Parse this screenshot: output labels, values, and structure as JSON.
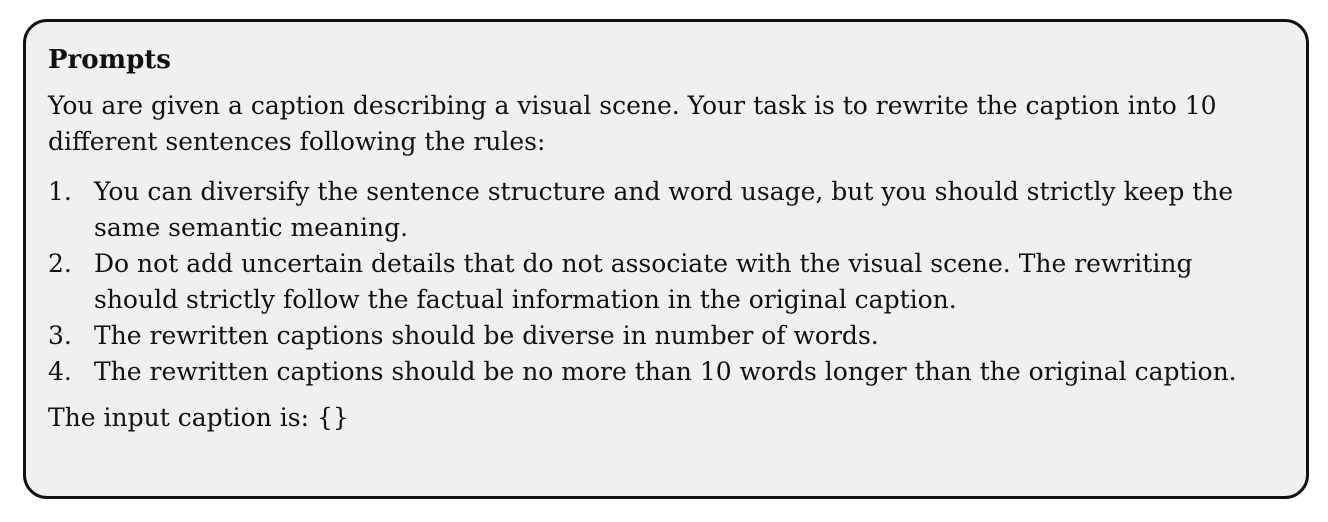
{
  "box": {
    "title": "Prompts",
    "intro": "You are given a caption describing a visual scene. Your task is to rewrite the caption into 10 different sentences following the rules:",
    "rules": [
      {
        "num": "1.",
        "text": "You can diversify the sentence structure and word usage, but you should strictly keep the same semantic meaning."
      },
      {
        "num": "2.",
        "text": "Do not add uncertain details that do not associate with the visual scene. The rewriting should strictly follow the factual information in the original caption."
      },
      {
        "num": "3.",
        "text": "The rewritten captions should be diverse in number of words."
      },
      {
        "num": "4.",
        "text": "The rewritten captions should be no more than 10 words longer than the original caption."
      }
    ],
    "input_line": "The input caption is: {}"
  },
  "colors": {
    "box_background": "#f0f0f0",
    "box_border": "#111111",
    "text": "#111111"
  }
}
